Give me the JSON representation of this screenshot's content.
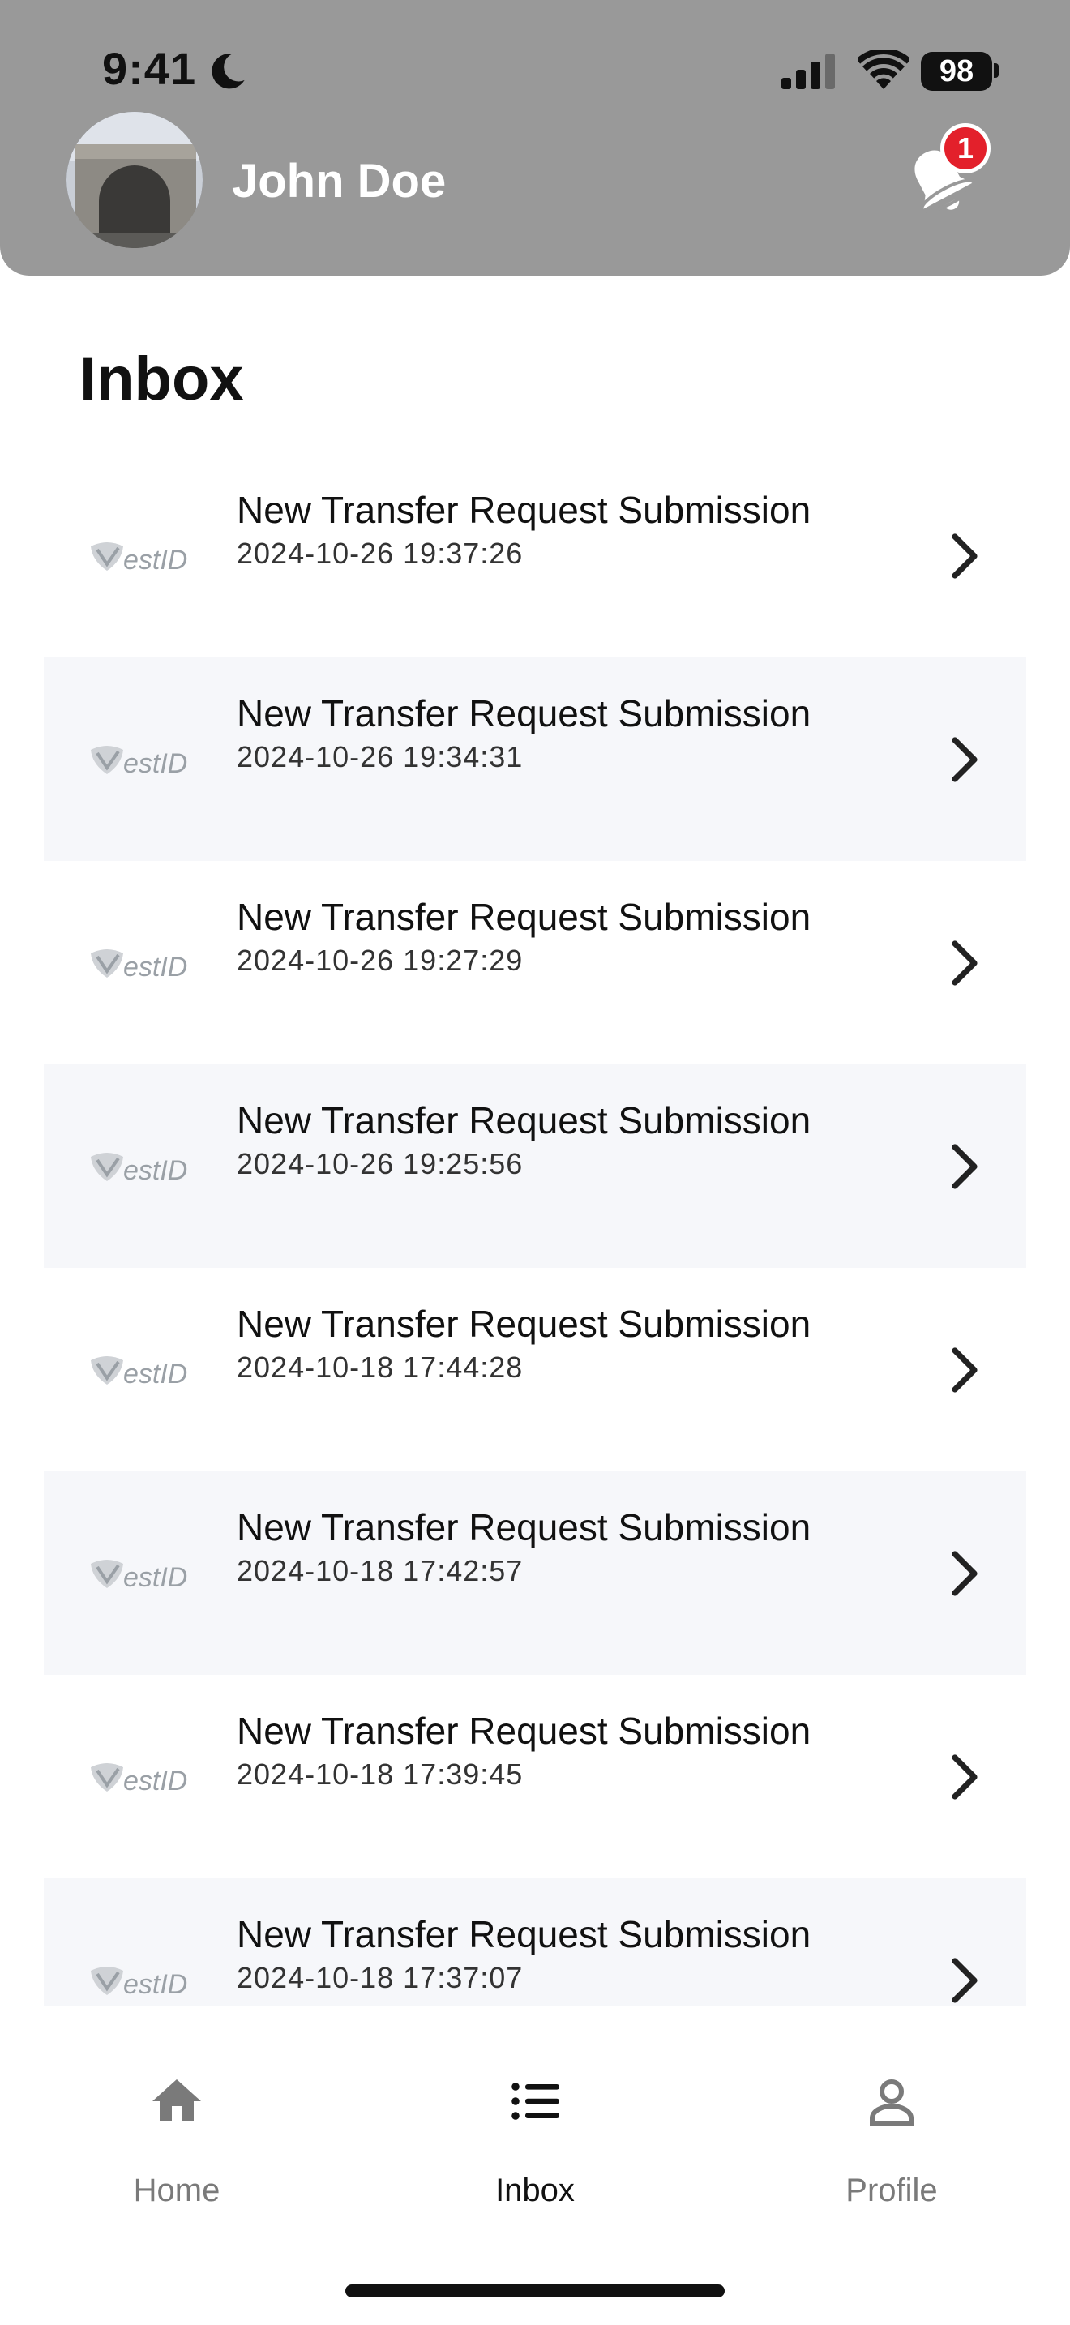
{
  "status_bar": {
    "time": "9:41",
    "battery": "98"
  },
  "header": {
    "user_name": "John Doe",
    "notification_count": "1"
  },
  "page": {
    "title": "Inbox"
  },
  "inbox": {
    "items": [
      {
        "title": "New Transfer Request Submission",
        "timestamp": "2024-10-26 19:37:26"
      },
      {
        "title": "New Transfer Request Submission",
        "timestamp": "2024-10-26 19:34:31"
      },
      {
        "title": "New Transfer Request Submission",
        "timestamp": "2024-10-26 19:27:29"
      },
      {
        "title": "New Transfer Request Submission",
        "timestamp": "2024-10-26 19:25:56"
      },
      {
        "title": "New Transfer Request Submission",
        "timestamp": "2024-10-18 17:44:28"
      },
      {
        "title": "New Transfer Request Submission",
        "timestamp": "2024-10-18 17:42:57"
      },
      {
        "title": "New Transfer Request Submission",
        "timestamp": "2024-10-18 17:39:45"
      },
      {
        "title": "New Transfer Request Submission",
        "timestamp": "2024-10-18 17:37:07"
      }
    ],
    "logo_text": "VestID"
  },
  "tab_bar": {
    "tabs": [
      {
        "label": "Home",
        "icon": "home-icon",
        "active": false
      },
      {
        "label": "Inbox",
        "icon": "list-icon",
        "active": true
      },
      {
        "label": "Profile",
        "icon": "person-icon",
        "active": false
      }
    ]
  },
  "colors": {
    "header_bg": "#999999",
    "badge": "#e3202b",
    "alt_row_bg": "#f6f7fa",
    "active_tab": "#111111",
    "inactive_tab": "#7a7a7a"
  }
}
